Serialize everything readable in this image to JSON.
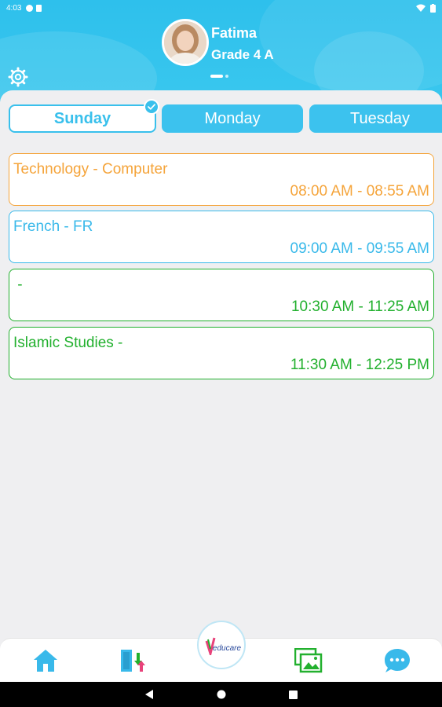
{
  "status_bar": {
    "time": "4:03"
  },
  "profile": {
    "name": "Fatima",
    "grade": "Grade 4 A"
  },
  "tabs": [
    {
      "label": "Sunday",
      "selected": true
    },
    {
      "label": "Monday",
      "selected": false
    },
    {
      "label": "Tuesday",
      "selected": false
    }
  ],
  "schedule": [
    {
      "subject": "Technology - Computer",
      "time": "08:00 AM - 08:55 AM",
      "color": "#f5a43a"
    },
    {
      "subject": "French - FR",
      "time": "09:00 AM - 09:55 AM",
      "color": "#39b9ea"
    },
    {
      "subject": " -",
      "time": "10:30 AM - 11:25 AM",
      "color": "#22b02e"
    },
    {
      "subject": "Islamic Studies -",
      "time": "11:30 AM - 12:25 PM",
      "color": "#22b02e"
    }
  ],
  "bottom_nav": {
    "items": [
      "home-icon",
      "door-exit-icon",
      "gallery-icon",
      "chat-icon"
    ],
    "logo_text": "educare"
  },
  "colors": {
    "accent": "#39c0ec",
    "header": "#2ec0ec"
  }
}
